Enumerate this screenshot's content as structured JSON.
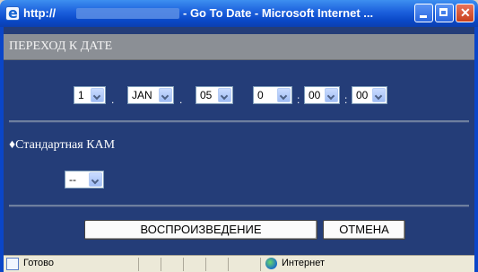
{
  "window": {
    "url_prefix": "http://",
    "title": "- Go To Date - Microsoft Internet ..."
  },
  "header": {
    "title": "ПЕРЕХОД К ДАТЕ"
  },
  "date_time": {
    "day": "1",
    "month": "JAN",
    "year": "05",
    "hour": "0",
    "minute": "00",
    "second": "00",
    "date_separator": ".",
    "time_separator": ":"
  },
  "camera": {
    "label": "♦Стандартная КАМ",
    "selected": "--"
  },
  "buttons": {
    "play": "ВОСПРОИЗВЕДЕНИЕ",
    "cancel": "ОТМЕНА"
  },
  "status_bar": {
    "status": "Готово",
    "zone": "Интернет"
  }
}
